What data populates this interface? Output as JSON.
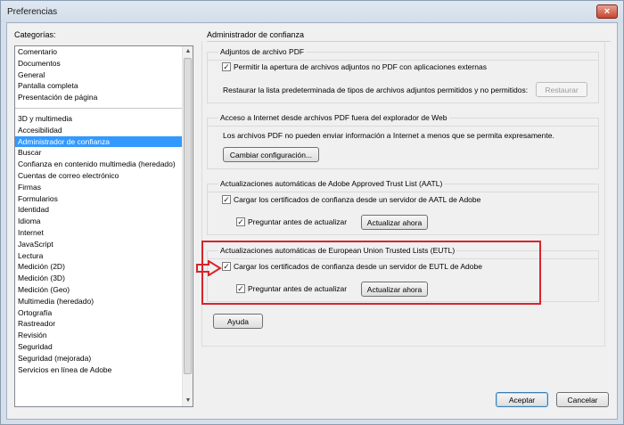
{
  "window": {
    "title": "Preferencias",
    "close_glyph": "×"
  },
  "categories": {
    "label": "Categorías:",
    "group1": [
      "Comentario",
      "Documentos",
      "General",
      "Pantalla completa",
      "Presentación de página"
    ],
    "group2": [
      "3D y multimedia",
      "Accesibilidad",
      "Administrador de confianza",
      "Buscar",
      "Confianza en contenido multimedia (heredado)",
      "Cuentas de correo electrónico",
      "Firmas",
      "Formularios",
      "Identidad",
      "Idioma",
      "Internet",
      "JavaScript",
      "Lectura",
      "Medición (2D)",
      "Medición (3D)",
      "Medición (Geo)",
      "Multimedia (heredado)",
      "Ortografía",
      "Rastreador",
      "Revisión",
      "Seguridad",
      "Seguridad (mejorada)",
      "Servicios en línea de Adobe"
    ],
    "selected": "Administrador de confianza"
  },
  "panel": {
    "title": "Administrador de confianza",
    "attachments": {
      "title": "Adjuntos de archivo PDF",
      "allow_label": "Permitir la apertura de archivos adjuntos no PDF con aplicaciones externas",
      "allow_checked": true,
      "restore_text": "Restaurar la lista predeterminada de tipos de archivos adjuntos permitidos y no permitidos:",
      "restore_button": "Restaurar"
    },
    "internet": {
      "title": "Acceso a Internet desde archivos PDF fuera del explorador de Web",
      "desc": "Los archivos PDF no pueden enviar información a Internet a menos que se permita expresamente.",
      "button": "Cambiar configuración..."
    },
    "aatl": {
      "title": "Actualizaciones automáticas de Adobe Approved Trust List (AATL)",
      "load_label": "Cargar los certificados de confianza desde un servidor de AATL de Adobe",
      "load_checked": true,
      "ask_label": "Preguntar antes de actualizar",
      "ask_checked": true,
      "update_button": "Actualizar ahora"
    },
    "eutl": {
      "title": "Actualizaciones automáticas de European Union Trusted Lists (EUTL)",
      "load_label": "Cargar los certificados de confianza desde un servidor de EUTL de Adobe",
      "load_checked": true,
      "ask_label": "Preguntar antes de actualizar",
      "ask_checked": true,
      "update_button": "Actualizar ahora"
    },
    "help_button": "Ayuda"
  },
  "footer": {
    "accept": "Aceptar",
    "cancel": "Cancelar"
  },
  "annotation": {
    "color": "#d9232b"
  }
}
